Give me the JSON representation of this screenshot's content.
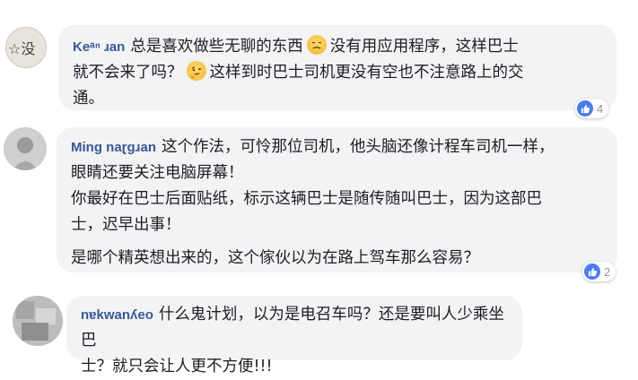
{
  "comments": [
    {
      "author": "Keᵃⁿ ɹan",
      "lines": [
        {
          "before": "总是喜欢做些无聊的东西",
          "emoji": "sad-face-icon",
          "after": "没有用应用程序，这样巴士"
        },
        {
          "before": "就不会来了吗？",
          "emoji": "thinking-face-icon",
          "after": "这样到时巴士司机更没有空也不注意路上的交"
        },
        {
          "before": "通。",
          "emoji": "",
          "after": ""
        }
      ],
      "reaction_count": "4",
      "avatar_text": "☆没"
    },
    {
      "author": "Ming naɽgɹan",
      "paragraphs": [
        [
          "这个作法，可怜那位司机，他头脑还像计程车司机一样，",
          "眼睛还要关注电脑屏幕！"
        ],
        [
          "你最好在巴士后面贴纸，标示这辆巴士是随传随叫巴士，因为这部巴",
          "士，迟早出事！"
        ],
        [
          "是哪个精英想出来的，这个傢伙以为在路上驾车那么容易？"
        ]
      ],
      "reaction_count": "2"
    },
    {
      "author": "nɐkwanʎeo",
      "lines": [
        "什么鬼计划，以为是电召车吗？还是要叫人少乘坐巴",
        "士？就只会让人更不方便!!!"
      ]
    }
  ],
  "colors": {
    "bubble": "#f2f3f5",
    "name": "#385898",
    "like": "#4a7df2"
  }
}
